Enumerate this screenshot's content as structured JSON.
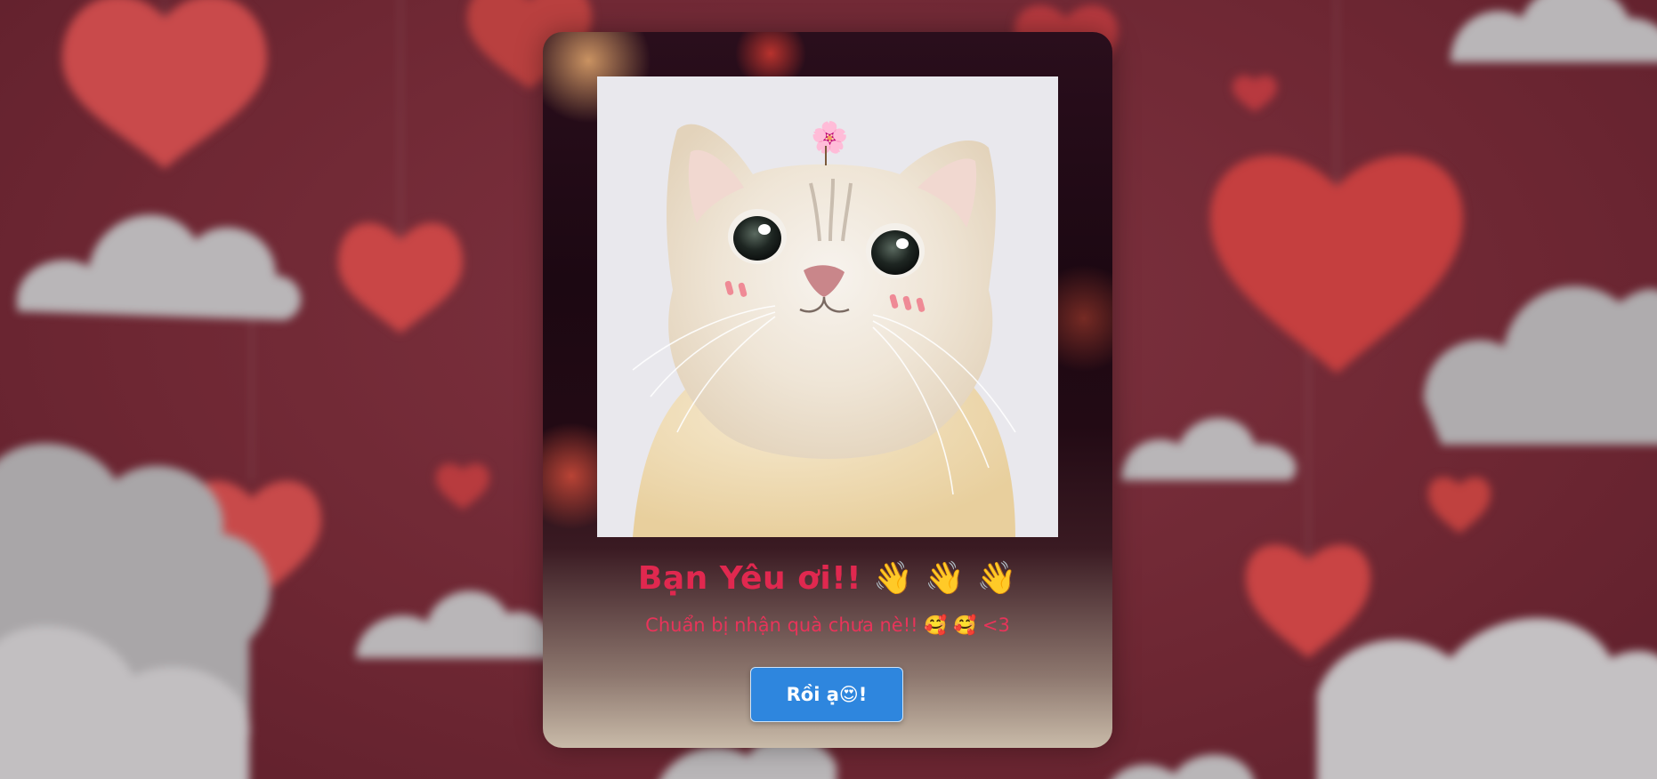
{
  "card": {
    "title": "Bạn Yêu ơi!!  👋 👋 👋",
    "subtitle": "Chuẩn bị nhận quà chưa nè!! 🥰 🥰 <3",
    "button_label": "Rồi ạ😍!"
  },
  "photo": {
    "flower_icon": "🌸"
  },
  "colors": {
    "accent": "#e0284f",
    "button": "#2e86de",
    "background": "#6e2733"
  }
}
